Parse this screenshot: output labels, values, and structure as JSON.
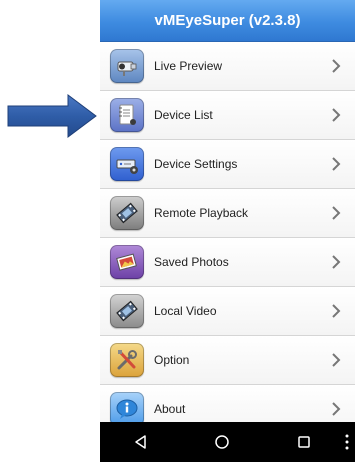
{
  "app": {
    "title": "vMEyeSuper (v2.3.8)"
  },
  "menu": {
    "items": [
      {
        "label": "Live Preview",
        "icon": "camera-icon",
        "tile_color": "#6f95c8"
      },
      {
        "label": "Device List",
        "icon": "notebook-icon",
        "tile_color": "#5f78c8"
      },
      {
        "label": "Device Settings",
        "icon": "dvr-gear-icon",
        "tile_color": "#3b6fd8"
      },
      {
        "label": "Remote Playback",
        "icon": "film-reel-icon",
        "tile_color": "#8c8c8c"
      },
      {
        "label": "Saved Photos",
        "icon": "photos-icon",
        "tile_color": "#8a5fb8"
      },
      {
        "label": "Local Video",
        "icon": "film-reel-icon",
        "tile_color": "#9a9a9a"
      },
      {
        "label": "Option",
        "icon": "tools-icon",
        "tile_color": "#e6b84a"
      },
      {
        "label": "About",
        "icon": "info-bubble-icon",
        "tile_color": "#3f93e6"
      }
    ]
  },
  "navbar": {
    "buttons": [
      "back-icon",
      "home-icon",
      "recents-icon",
      "overflow-menu-icon"
    ]
  },
  "colors": {
    "titlebar": "#3e8be0",
    "pointer_arrow": "#2f5da8"
  }
}
